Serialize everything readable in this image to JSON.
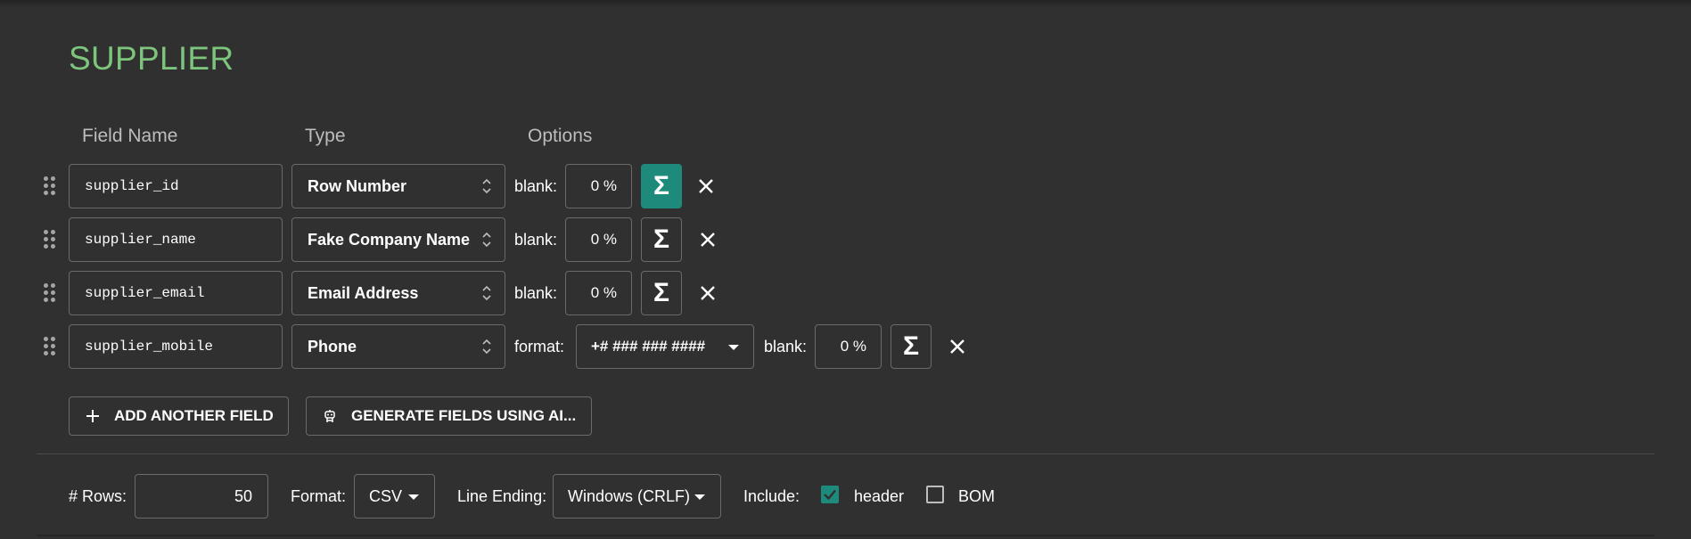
{
  "schema_title": "SUPPLIER",
  "columns": {
    "field_name": "Field Name",
    "type": "Type",
    "options": "Options"
  },
  "fields": [
    {
      "name": "supplier_id",
      "type": "Row Number",
      "blank_label": "blank:",
      "blank_value": "0 %",
      "sigma": "Σ",
      "sigma_active": true
    },
    {
      "name": "supplier_name",
      "type": "Fake Company Name",
      "blank_label": "blank:",
      "blank_value": "0 %",
      "sigma": "Σ",
      "sigma_active": false
    },
    {
      "name": "supplier_email",
      "type": "Email Address",
      "blank_label": "blank:",
      "blank_value": "0 %",
      "sigma": "Σ",
      "sigma_active": false
    },
    {
      "name": "supplier_mobile",
      "type": "Phone",
      "format_label": "format:",
      "format_value": "+# ### ### ####",
      "blank_label": "blank:",
      "blank_value": "0 %",
      "sigma": "Σ",
      "sigma_active": false
    }
  ],
  "actions": {
    "add_field": "ADD ANOTHER FIELD",
    "generate_ai": "GENERATE FIELDS USING AI..."
  },
  "footer": {
    "rows_label": "# Rows:",
    "rows_value": "50",
    "format_label": "Format:",
    "format_value": "CSV",
    "line_ending_label": "Line Ending:",
    "line_ending_value": "Windows (CRLF)",
    "include_label": "Include:",
    "header_label": "header",
    "header_checked": true,
    "bom_label": "BOM",
    "bom_checked": false
  },
  "colors": {
    "background": "#303030",
    "title": "#7dc47d",
    "accent": "#1e8a7c",
    "border": "#6a6a6a"
  },
  "icons": {
    "drag": "drag-handle-icon",
    "updown": "unfold-icon",
    "remove": "close-icon",
    "add": "plus-icon",
    "ai": "robot-icon",
    "dropdown": "caret-down-icon",
    "check": "check-icon"
  }
}
